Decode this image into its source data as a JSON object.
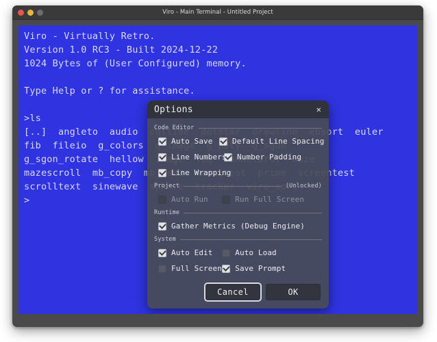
{
  "window": {
    "title": "Viro - Main Terminal - Untitled Project",
    "traffic_lights": [
      {
        "name": "close",
        "color": "#e8554a"
      },
      {
        "name": "minimize",
        "color": "#e8b33a"
      },
      {
        "name": "zoom",
        "color": "#6d6d6d"
      }
    ]
  },
  "terminal": {
    "background": "#2f33e0",
    "foreground": "#d8d8e8",
    "lines": [
      "Viro - Virtually Retro.",
      "Version 1.0 RC3 - Built 2024-12-22",
      "1024 Bytes of (User Configured) memory.",
      "",
      "Type Help or ? for assistance.",
      "",
      ">ls",
      "[..]  angleto  audio  collide  dotstar  drawline  ebsort  euler",
      "fib  fileio  g_colors  g_image  g_poly  g_sgon",
      "g_sgon_rotate  hellow  image  ltq  mandelbrot  maze",
      "mazescroll  mb_copy  mb_read  mousetest  prime  screentest",
      "scrolltext  sinewave  sphere  tracker  viro_sort",
      ">"
    ]
  },
  "dialog": {
    "title": "Options",
    "close_icon": "close-icon",
    "groups": [
      {
        "name": "Code Editor",
        "tag": "",
        "rows": [
          [
            {
              "label": "Auto Save",
              "checked": true,
              "disabled": false
            },
            {
              "label": "Default Line Spacing",
              "checked": true,
              "disabled": false
            }
          ],
          [
            {
              "label": "Line Numbers",
              "checked": true,
              "disabled": false
            },
            {
              "label": "Number Padding",
              "checked": true,
              "disabled": false
            }
          ],
          [
            {
              "label": "Line Wrapping",
              "checked": true,
              "disabled": false
            }
          ]
        ]
      },
      {
        "name": "Project",
        "tag": "(Unlocked)",
        "rows": [
          [
            {
              "label": "Auto Run",
              "checked": false,
              "disabled": true
            },
            {
              "label": "Run Full Screen",
              "checked": false,
              "disabled": true
            }
          ]
        ]
      },
      {
        "name": "Runtime",
        "tag": "",
        "rows": [
          [
            {
              "label": "Gather Metrics (Debug Engine)",
              "checked": true,
              "disabled": false
            }
          ]
        ]
      },
      {
        "name": "System",
        "tag": "",
        "rows": [
          [
            {
              "label": "Auto Edit",
              "checked": true,
              "disabled": false
            },
            {
              "label": "Auto Load",
              "checked": false,
              "disabled": false
            }
          ],
          [
            {
              "label": "Full Screen",
              "checked": false,
              "disabled": false
            },
            {
              "label": "Save Prompt",
              "checked": true,
              "disabled": false
            }
          ]
        ]
      }
    ],
    "buttons": [
      {
        "label": "Cancel",
        "focused": true
      },
      {
        "label": "OK",
        "focused": false
      }
    ]
  }
}
